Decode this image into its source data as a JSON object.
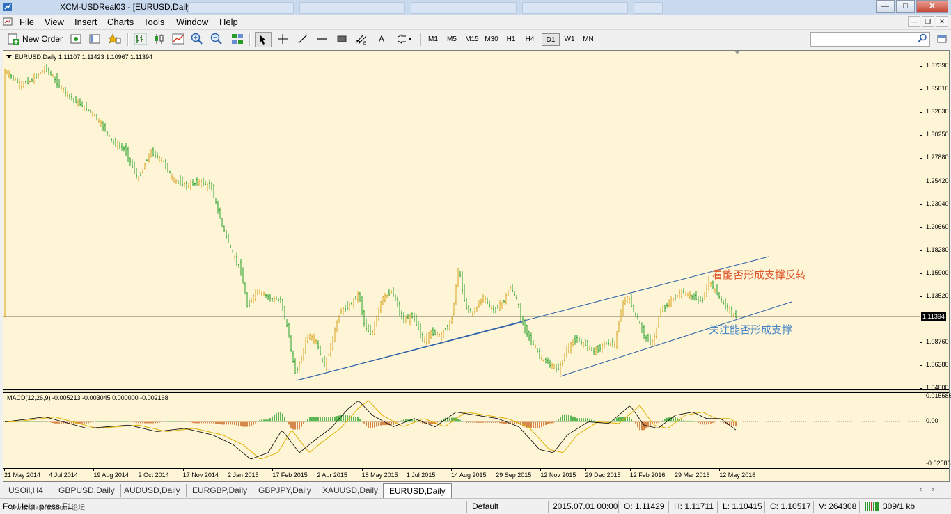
{
  "window": {
    "title": "XCM-USDReal03 - [EURUSD,Daily]"
  },
  "menu": {
    "items": [
      "File",
      "View",
      "Insert",
      "Charts",
      "Tools",
      "Window",
      "Help"
    ]
  },
  "toolbar": {
    "new_order_label": "New Order",
    "timeframes": [
      "M1",
      "M5",
      "M15",
      "M30",
      "H1",
      "H4",
      "D1",
      "W1",
      "MN"
    ],
    "active_timeframe": "D1",
    "search_value": ""
  },
  "chart": {
    "header": "EURUSD,Daily  1.11107 1.11423 1.10967 1.11394",
    "current_price": "1.11394",
    "price_axis": [
      "1.37390",
      "1.35010",
      "1.32630",
      "1.30250",
      "1.27880",
      "1.25420",
      "1.23040",
      "1.20660",
      "1.18280",
      "1.15900",
      "1.13520",
      "1.08760",
      "1.06380",
      "1.04000"
    ],
    "macd_header": "MACD(12,26,9) -0.005213 -0.003045 0.000000 -0.002168",
    "macd_axis": [
      "0.015586",
      "0.00",
      "-0.025864"
    ],
    "time_axis": [
      "21 May 2014",
      "4 Jul 2014",
      "19 Aug 2014",
      "2 Oct 2014",
      "17 Nov 2014",
      "2 Jan 2015",
      "17 Feb 2015",
      "2 Apr 2015",
      "18 May 2015",
      "1 Jul 2015",
      "14 Aug 2015",
      "29 Sep 2015",
      "12 Nov 2015",
      "29 Dec 2015",
      "12 Feb 2016",
      "29 Mar 2016",
      "12 May 2016"
    ],
    "annotation_upper": "看能否形成支撑反转",
    "annotation_lower": "关注能否形成支撑",
    "colors": {
      "background": "#fdf5d6",
      "bull_candle": "#d6a21f",
      "bear_candle": "#27a12b",
      "trendline": "#2a5ea8",
      "macd_line": "#000000",
      "signal_line": "#e0b000",
      "hist_up": "#2aa02a",
      "hist_down": "#c8641e",
      "annotation_upper": "#e0552a",
      "annotation_lower": "#4a86c6"
    }
  },
  "chart_tabs": {
    "items": [
      "USOil,H4",
      "GBPUSD,Daily",
      "AUDUSD,Daily",
      "EURGBP,Daily",
      "GBPJPY,Daily",
      "XAUUSD,Daily",
      "EURUSD,Daily"
    ],
    "active": "EURUSD,Daily"
  },
  "status": {
    "left": "For Help, press F1",
    "left_overlay": "www.talkforex.com 论坛",
    "profile": "Default",
    "datetime": "2015.07.01 00:00",
    "open": "O: 1.11429",
    "high": "H: 1.11711",
    "low": "L: 1.10415",
    "close": "C: 1.10517",
    "volume": "V: 264308",
    "traffic": "309/1 kb"
  }
}
